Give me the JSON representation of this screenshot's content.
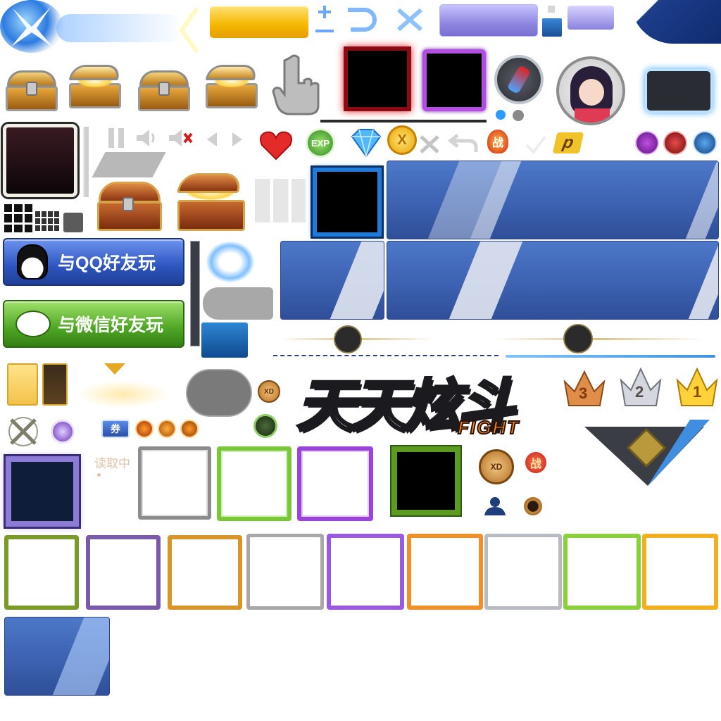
{
  "buttons": {
    "qq_label": "与QQ好友玩",
    "wechat_label": "与微信好友玩"
  },
  "logo": {
    "title_cn": "天天炫斗",
    "title_en": "FIGHT"
  },
  "loading": {
    "text": "读取中"
  },
  "badges": {
    "exp": "EXP",
    "battle": "战",
    "battle2": "战",
    "coupon": "券",
    "coin": "X",
    "points": "p",
    "xd": "XD",
    "xd2": "XD"
  },
  "ranks": {
    "third": "3",
    "second": "2",
    "first": "1"
  },
  "colors": {
    "panel_blue": "#3c62b1",
    "qq_button": "#3a63c4",
    "wechat_button": "#5fae2e",
    "gold": "#f7c341"
  }
}
